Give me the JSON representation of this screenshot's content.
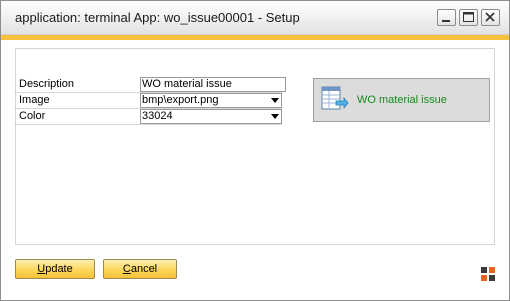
{
  "window": {
    "title": "application: terminal App: wo_issue00001 - Setup",
    "buttons": {
      "minimize": "minimize-icon",
      "maximize": "maximize-icon",
      "close": "close-icon"
    }
  },
  "form": {
    "description": {
      "label": "Description",
      "value": "WO material issue"
    },
    "image": {
      "label": "Image",
      "value": "bmp\\export.png"
    },
    "color": {
      "label": "Color",
      "value": "33024"
    }
  },
  "preview": {
    "label": "WO material issue",
    "label_color": "#1a8a1a",
    "icon": "table-export-icon"
  },
  "actions": {
    "update": {
      "mnemonic": "U",
      "rest": "pdate"
    },
    "cancel": {
      "mnemonic": "C",
      "rest": "ancel"
    }
  },
  "colors": {
    "accent": "#f6c23e",
    "button": "#fbd65a"
  },
  "corner_icon": "resize-grip-icon"
}
